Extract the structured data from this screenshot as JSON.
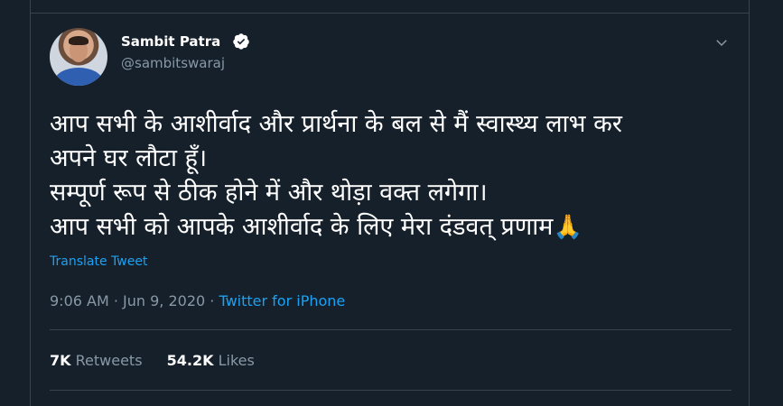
{
  "user": {
    "display_name": "Sambit Patra",
    "handle": "@sambitswaraj"
  },
  "tweet": {
    "lines": [
      "आप सभी के आशीर्वाद और प्रार्थना के बल से मैं स्वास्थ्य लाभ कर",
      "अपने घर लौटा हूँ।",
      "सम्पूर्ण रूप से ठीक होने में और थोड़ा वक्त लगेगा।",
      "आप सभी को आपके आशीर्वाद के लिए मेरा दंडवत् प्रणाम"
    ],
    "emoji": "🙏",
    "translate_label": "Translate Tweet"
  },
  "meta": {
    "time": "9:06 AM",
    "separator": " · ",
    "date": "Jun 9, 2020",
    "source": "Twitter for iPhone"
  },
  "stats": {
    "retweets_count": "7K",
    "retweets_label": "Retweets",
    "likes_count": "54.2K",
    "likes_label": "Likes"
  },
  "icons": {
    "verified": "verified-badge-icon",
    "caret": "chevron-down-icon"
  },
  "colors": {
    "background": "#15202b",
    "accent": "#1da1f2",
    "muted": "#8899a6",
    "border": "#38444d"
  }
}
